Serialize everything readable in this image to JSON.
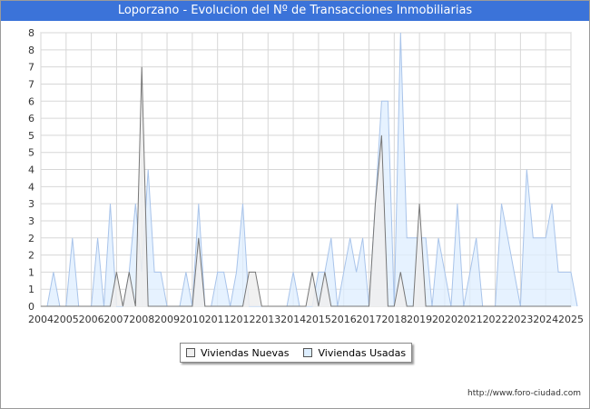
{
  "title": "Loporzano - Evolucion del Nº de Transacciones Inmobiliarias",
  "footer": "http://www.foro-ciudad.com",
  "colors": {
    "title_bg": "#3b73d9",
    "nuevas_line": "#777777",
    "nuevas_fill": "#efefef",
    "usadas_line": "#a9c4ea",
    "usadas_fill": "#ddeeff",
    "grid": "#d7d7d7"
  },
  "chart_data": {
    "type": "area",
    "frequency": "quarterly",
    "x_start_year": 2004,
    "xlim": [
      2004,
      2025
    ],
    "ylim": [
      0,
      8
    ],
    "y_ticks": [
      "0",
      "1",
      "1",
      "2",
      "2",
      "3",
      "3",
      "4",
      "4",
      "5",
      "5",
      "6",
      "6",
      "7",
      "7",
      "8",
      "8"
    ],
    "x_ticks": [
      "2004",
      "2005",
      "2006",
      "2007",
      "2008",
      "2009",
      "2010",
      "2011",
      "2012",
      "2013",
      "2014",
      "2015",
      "2016",
      "2017",
      "2018",
      "2019",
      "2020",
      "2021",
      "2022",
      "2023",
      "2024",
      "2025"
    ],
    "grid": true,
    "legend_position": "bottom-center",
    "series": [
      {
        "name": "Viviendas Nuevas",
        "values": [
          0,
          0,
          0,
          0,
          0,
          0,
          0,
          0,
          0,
          0,
          0,
          0,
          1,
          0,
          1,
          0,
          7,
          0,
          0,
          0,
          0,
          0,
          0,
          0,
          0,
          2,
          0,
          0,
          0,
          0,
          0,
          0,
          0,
          1,
          1,
          0,
          0,
          0,
          0,
          0,
          0,
          0,
          0,
          1,
          0,
          1,
          0,
          0,
          0,
          0,
          0,
          0,
          0,
          3,
          5,
          0,
          0,
          1,
          0,
          0,
          3,
          0,
          0,
          0,
          0,
          0,
          0,
          0,
          0,
          0,
          0,
          0,
          0,
          0,
          0,
          0,
          0,
          0,
          0,
          0,
          0,
          0,
          0,
          0,
          0
        ]
      },
      {
        "name": "Viviendas Usadas",
        "values": [
          0,
          0,
          1,
          0,
          0,
          2,
          0,
          0,
          0,
          2,
          0,
          3,
          0,
          0,
          1,
          3,
          1,
          4,
          1,
          1,
          0,
          0,
          0,
          1,
          0,
          3,
          0,
          0,
          1,
          1,
          0,
          1,
          3,
          0,
          0,
          0,
          0,
          0,
          0,
          0,
          1,
          0,
          0,
          0,
          1,
          1,
          2,
          0,
          1,
          2,
          1,
          2,
          0,
          3,
          6,
          6,
          0,
          8,
          2,
          2,
          2,
          2,
          0,
          2,
          1,
          0,
          3,
          0,
          1,
          2,
          0,
          0,
          0,
          3,
          2,
          1,
          0,
          4,
          2,
          2,
          2,
          3,
          1,
          1,
          1,
          0
        ]
      }
    ]
  }
}
